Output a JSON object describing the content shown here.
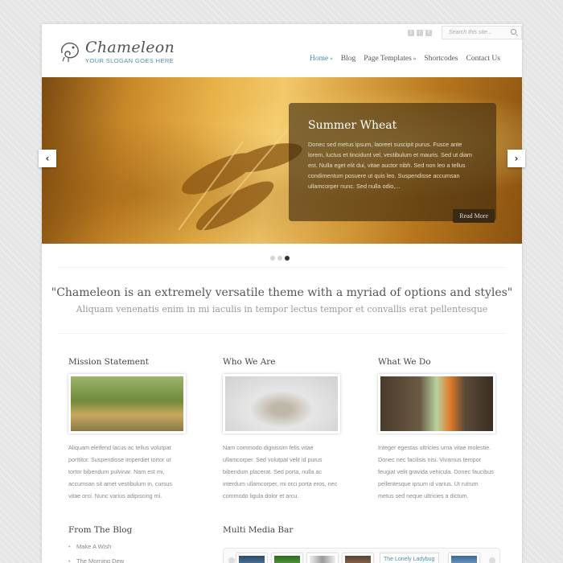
{
  "header": {
    "logo_name": "Chameleon",
    "slogan": "YOUR SLOGAN GOES HERE",
    "search_placeholder": "Search this site...",
    "social": [
      "twitter-icon",
      "rss-icon",
      "facebook-icon"
    ]
  },
  "nav": {
    "items": [
      {
        "label": "Home",
        "active": true,
        "has_arrow": true
      },
      {
        "label": "Blog",
        "active": false,
        "has_arrow": false
      },
      {
        "label": "Page Templates",
        "active": false,
        "has_arrow": true
      },
      {
        "label": "Shortcodes",
        "active": false,
        "has_arrow": false
      },
      {
        "label": "Contact Us",
        "active": false,
        "has_arrow": false
      }
    ]
  },
  "slider": {
    "title": "Summer Wheat",
    "text": "Donec sed metus ipsum, laoreet suscipit purus. Fusce ante lorem, luctus et tincidunt vel, vestibulum et mauris. Sed ut diam est. Nulla eget elit dui, vitae auctor nibh. Sed non leo a tellus condimentum posuere ut quis leo. Suspendisse accumsan ullamcorper nunc. Sed nulla odio,...",
    "read_more": "Read More",
    "slides": 3,
    "active_slide": 3
  },
  "quote": {
    "main": "\"Chameleon is an extremely versatile theme with a myriad of options and styles\"",
    "sub": "Aliquam venenatis enim in mi iaculis in tempor lectus tempor et convallis erat pellentesque"
  },
  "columns": [
    {
      "title": "Mission Statement",
      "text": "Aliquam eleifend lacus ac tellus volutpat porttitor. Suspendisse imperdiet tortor ut tortor bibendum pulvinar. Nam est mi, accumsan sit amet vestibulum in, cursus vitae orci. Nunc varius adipiscing mi."
    },
    {
      "title": "Who We Are",
      "text": "Nam commodo dignissim felis vitae ullamcorper. Sed volutpat velit id purus bibendum placerat. Sed porta, nulla ac interdum ullamcorper, mi orci porta eros, nec commodo ligula dolor et arcu."
    },
    {
      "title": "What We Do",
      "text": "Integer egestas ultricies urna vitae molestie. Donec nec facilisis nisi. Vivamus tempor feugiat velit gravida vehicula. Donec faucibus pellentesque ipsum id varius. Ut rutrum metus sed neque ultricies a dictum."
    }
  ],
  "blog": {
    "title": "From The Blog",
    "items": [
      "Make A Wish",
      "The Morning Dew"
    ]
  },
  "multimedia": {
    "title": "Multi Media Bar",
    "text_item": "The Lonely Ladybug"
  }
}
